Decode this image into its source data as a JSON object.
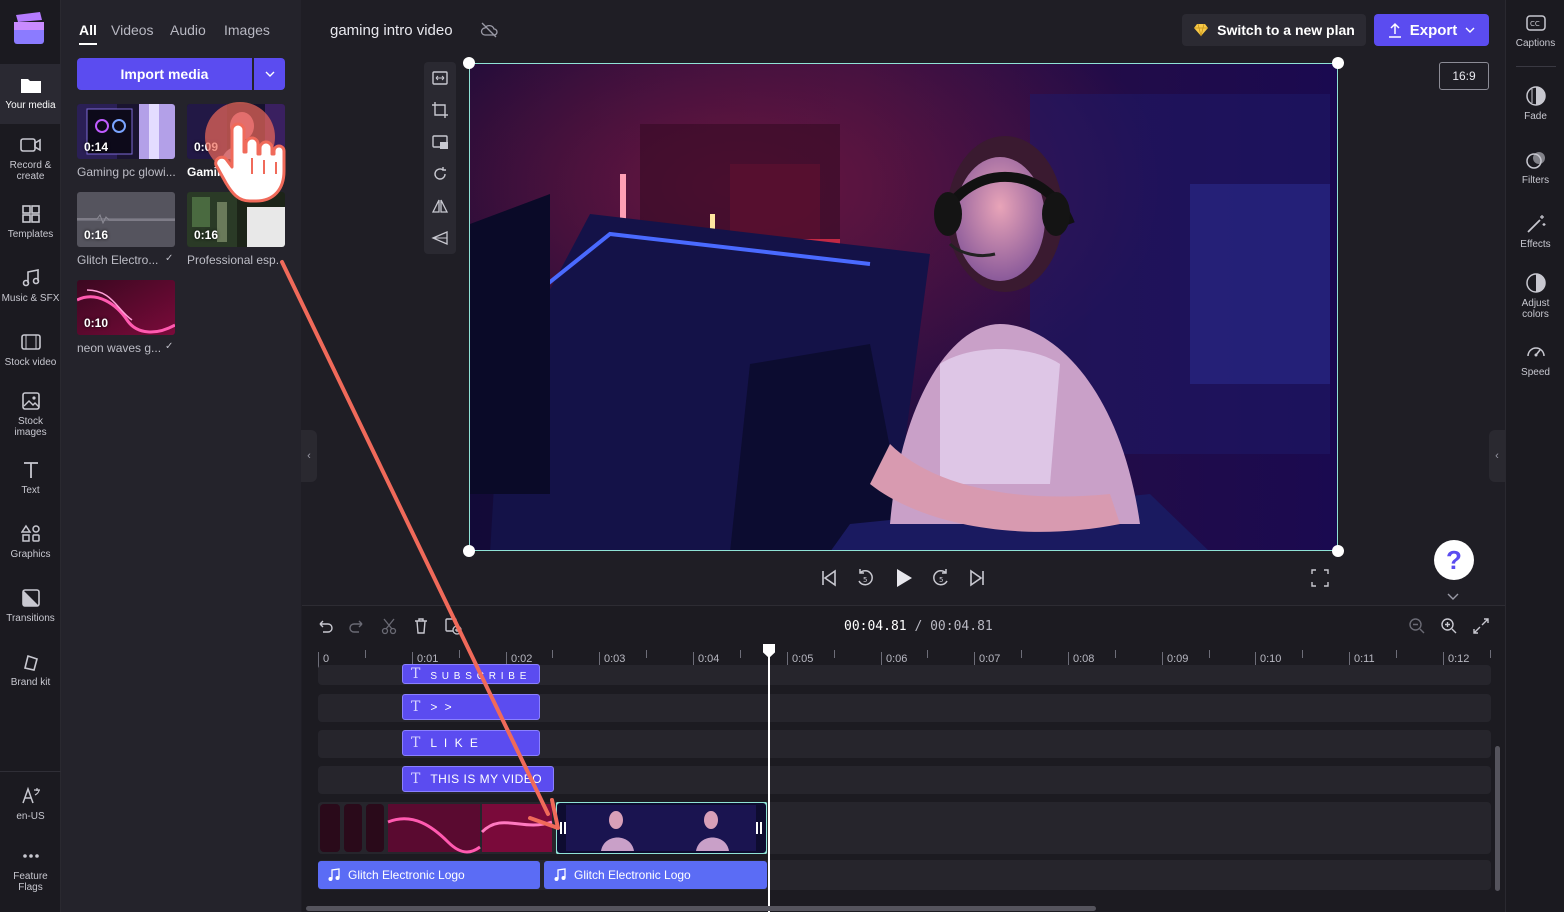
{
  "left_rail": {
    "items": [
      {
        "label": "Your media",
        "icon": "folder-icon"
      },
      {
        "label": "Record & create",
        "icon": "camera-icon"
      },
      {
        "label": "Templates",
        "icon": "templates-icon"
      },
      {
        "label": "Music & SFX",
        "icon": "music-icon"
      },
      {
        "label": "Stock video",
        "icon": "film-icon"
      },
      {
        "label": "Stock images",
        "icon": "image-icon"
      },
      {
        "label": "Text",
        "icon": "text-icon"
      },
      {
        "label": "Graphics",
        "icon": "shapes-icon"
      },
      {
        "label": "Transitions",
        "icon": "transitions-icon"
      },
      {
        "label": "Brand kit",
        "icon": "brand-kit-icon"
      }
    ],
    "bottom_items": [
      {
        "label": "en-US",
        "icon": "language-icon"
      },
      {
        "label": "Feature Flags",
        "icon": "more-icon"
      }
    ]
  },
  "media_panel": {
    "tabs": [
      "All",
      "Videos",
      "Audio",
      "Images"
    ],
    "import_label": "Import media",
    "items": [
      {
        "duration": "0:14",
        "label": "Gaming pc glowi..."
      },
      {
        "duration": "0:09",
        "label": "Gaming"
      },
      {
        "duration": "0:16",
        "label": "Glitch Electro..."
      },
      {
        "duration": "0:16",
        "label": "Professional esp..."
      },
      {
        "duration": "0:10",
        "label": "neon waves g..."
      }
    ]
  },
  "header": {
    "project_title": "gaming intro video",
    "plan_label": "Switch to a new plan",
    "export_label": "Export",
    "aspect_ratio": "16:9"
  },
  "right_rail": {
    "items": [
      {
        "label": "Captions",
        "icon": "captions-icon"
      },
      {
        "label": "Fade",
        "icon": "fade-icon"
      },
      {
        "label": "Filters",
        "icon": "filters-icon"
      },
      {
        "label": "Effects",
        "icon": "effects-icon"
      },
      {
        "label": "Adjust colors",
        "icon": "adjust-colors-icon"
      },
      {
        "label": "Speed",
        "icon": "speed-icon"
      }
    ]
  },
  "help_label": "?",
  "timeline": {
    "current_time": "00:04.81",
    "total_time": "/ 00:04.81",
    "ruler": [
      "0",
      "0:01",
      "0:02",
      "0:03",
      "0:04",
      "0:05",
      "0:06",
      "0:07",
      "0:08",
      "0:09",
      "0:10",
      "0:11",
      "0:12"
    ],
    "text_clips": [
      "S U B S C R I B E",
      "> >",
      "L I K E",
      "THIS IS MY VIDEO"
    ],
    "audio_clips": [
      "Glitch Electronic Logo",
      "Glitch Electronic Logo"
    ]
  },
  "colors": {
    "accent": "#5b4cf0",
    "selection": "#8fe3d6",
    "drag_arrow": "#f06a5a"
  }
}
